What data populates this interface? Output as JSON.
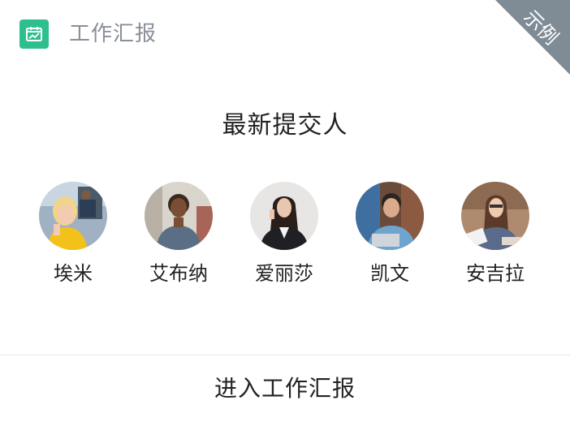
{
  "header": {
    "title": "工作汇报",
    "icon": "calendar-chart-icon",
    "accent_color": "#2dbf8e"
  },
  "ribbon": {
    "label": "示例",
    "color": "#7f8c95"
  },
  "section": {
    "title": "最新提交人"
  },
  "people": [
    {
      "name": "埃米",
      "avatar": "avatar-photo"
    },
    {
      "name": "艾布纳",
      "avatar": "avatar-photo"
    },
    {
      "name": "爱丽莎",
      "avatar": "avatar-photo"
    },
    {
      "name": "凯文",
      "avatar": "avatar-photo"
    },
    {
      "name": "安吉拉",
      "avatar": "avatar-photo"
    }
  ],
  "footer": {
    "link_label": "进入工作汇报"
  }
}
